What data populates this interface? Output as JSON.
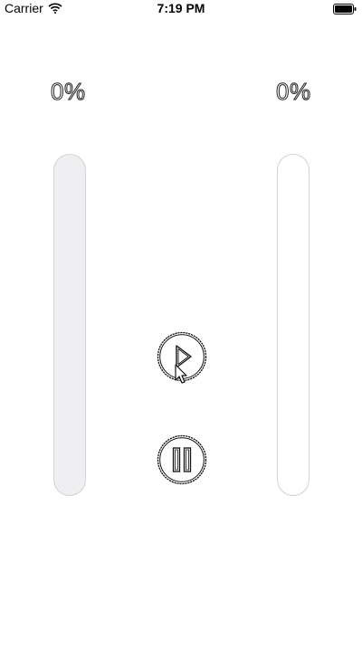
{
  "status_bar": {
    "carrier": "Carrier",
    "time": "7:19 PM",
    "wifi_icon": "wifi-icon",
    "battery_icon": "battery-icon"
  },
  "meters": {
    "left": {
      "label": "0%",
      "level": 0
    },
    "right": {
      "label": "0%",
      "level": 0
    }
  },
  "controls": {
    "play_icon": "play-icon",
    "pause_icon": "pause-icon"
  },
  "colors": {
    "left_track_bg": "#efeff2",
    "right_track_bg": "#ffffff",
    "track_border": "#d2d2d6"
  }
}
